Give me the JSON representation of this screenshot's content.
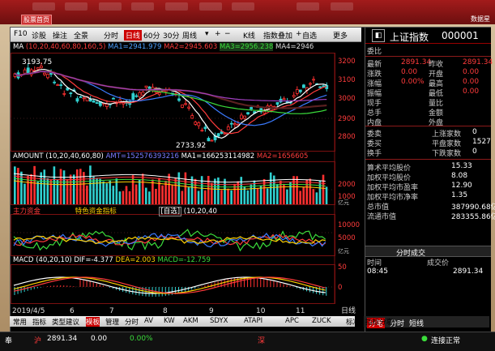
{
  "window": {
    "tab": "股票首页",
    "right_label": "数据星"
  },
  "toolbar": {
    "items": [
      "F10",
      "诊股",
      "操注",
      "全景",
      "分时",
      "日线",
      "60分",
      "30分",
      "周线"
    ],
    "period_sel": "日线",
    "more": "更多",
    "k_line": "K线",
    "stack": "指数叠加",
    "watch": "自选"
  },
  "ma": {
    "title": "MA",
    "params": "(10,20,40,60,80,160,5)",
    "ma1": "MA1=2941.979",
    "ma2": "MA2=2945.603",
    "ma3": "MA3=2956.238",
    "ma4": "MA4=2946"
  },
  "price_chart": {
    "high_label": "3193.75",
    "low_label": "2733.92",
    "axis": [
      "3200",
      "3100",
      "3000",
      "2900",
      "2800"
    ]
  },
  "volume": {
    "title": "AMOUNT",
    "params": "(10,20,40,60,80)",
    "amt": "AMT=152576393216",
    "ma1": "MA1=166253114982",
    "ma2": "MA2=1656605",
    "axis": [
      "2000",
      "1000"
    ],
    "unit": "亿元"
  },
  "ind1": {
    "title": "主力资金",
    "mid": "特色资金指标",
    "btn": "[自选]",
    "params": "(10,20,40",
    "axis": [
      "10000",
      "5000"
    ],
    "unit": "亿元"
  },
  "macd": {
    "title": "MACD",
    "params": "(40,20,10)",
    "dif": "DIF=-4.377",
    "dea": "DEA=2.003",
    "macd": "MACD=-12.759",
    "axis": [
      "50",
      "0"
    ]
  },
  "xaxis": {
    "labels": [
      "2019/4/5",
      "6",
      "7",
      "8",
      "9",
      "10",
      "11"
    ],
    "right": "日线"
  },
  "right_panel": {
    "name": "上证指数",
    "code": "000001",
    "weibi": "委比",
    "rows": [
      {
        "l1": "最新",
        "v1": "2891.34",
        "l2": "昨收",
        "v2": "2891.34"
      },
      {
        "l1": "涨跌",
        "v1": "0.00",
        "l2": "开盘",
        "v2": "0.00"
      },
      {
        "l1": "涨幅",
        "v1": "0.00%",
        "l2": "最高",
        "v2": "0.00"
      },
      {
        "l1": "振幅",
        "v1": "",
        "l2": "最低",
        "v2": "0.00"
      },
      {
        "l1": "现手",
        "v1": "",
        "l2": "量比",
        "v2": ""
      },
      {
        "l1": "总手",
        "v1": "",
        "l2": "金额",
        "v2": ""
      },
      {
        "l1": "内盘",
        "v1": "",
        "l2": "外盘",
        "v2": ""
      }
    ],
    "rows2": [
      {
        "l1": "委卖",
        "v1": "",
        "l2": "上涨家数",
        "v2": "0"
      },
      {
        "l1": "委买",
        "v1": "",
        "l2": "平盘家数",
        "v2": "1527"
      },
      {
        "l1": "换手",
        "v1": "",
        "l2": "下跌家数",
        "v2": "0"
      }
    ],
    "rows3": [
      {
        "l": "算术平均股价",
        "v": "15.33"
      },
      {
        "l": "加权平均股价",
        "v": "8.08"
      },
      {
        "l": "加权平均市盈率",
        "v": "12.90"
      },
      {
        "l": "加权平均市净率",
        "v": "1.35"
      },
      {
        "l": "总市值",
        "v": "387990.68亿"
      },
      {
        "l": "流通市值",
        "v": "283355.86亿"
      }
    ],
    "subtab": "分时成交",
    "cols": {
      "time": "时间",
      "price": "成交价"
    },
    "trade": {
      "time": "08:45",
      "price": "2891.34"
    },
    "bottom_tabs": [
      "分笔",
      "分时",
      "短线"
    ]
  },
  "bottombar": {
    "items": [
      "常用",
      "指标",
      "类型建议",
      "模板",
      "管理",
      "分时",
      "AV",
      "KW",
      "AKM",
      "SDYX",
      "ATAPI",
      "APC",
      "ZUCK",
      "标准",
      "指标分享"
    ]
  },
  "status": {
    "left": "奉",
    " code": "沪",
    "price": "2891.34",
    "chg": "0.00",
    "pct": "0.00%",
    "mid": "深",
    "right": "连接正常"
  }
}
